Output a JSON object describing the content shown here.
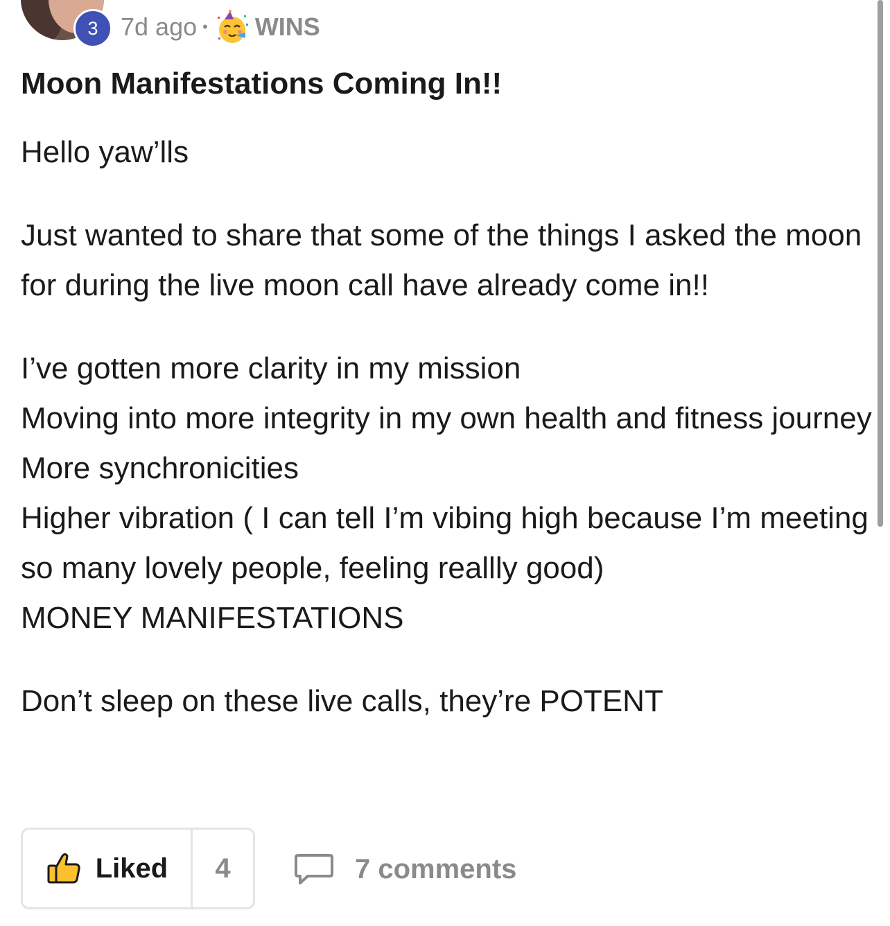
{
  "author": {
    "level": "3"
  },
  "meta": {
    "time": "7d ago",
    "separator": "•",
    "category_icon": "partying-face-emoji",
    "category": "WINS"
  },
  "post": {
    "title": "Moon Manifestations Coming In!!",
    "paragraphs": [
      [
        "Hello yaw’lls"
      ],
      [
        "Just wanted to share that some of the things I asked the moon for during the live moon call have already come in!!"
      ],
      [
        "I’ve gotten more clarity in my mission",
        "Moving into more integrity in my own health and fitness journey",
        "More synchronicities",
        "Higher vibration ( I can tell I’m vibing high because I’m meeting so many lovely people, feeling reallly good)",
        "MONEY MANIFESTATIONS"
      ],
      [
        "Don’t sleep on these live calls, they’re POTENT"
      ]
    ]
  },
  "actions": {
    "like_label": "Liked",
    "like_count": "4",
    "comments_label": "7 comments"
  },
  "colors": {
    "badge": "#3f51b5",
    "muted_text": "#8a8a8a",
    "border": "#e4e4e4"
  }
}
